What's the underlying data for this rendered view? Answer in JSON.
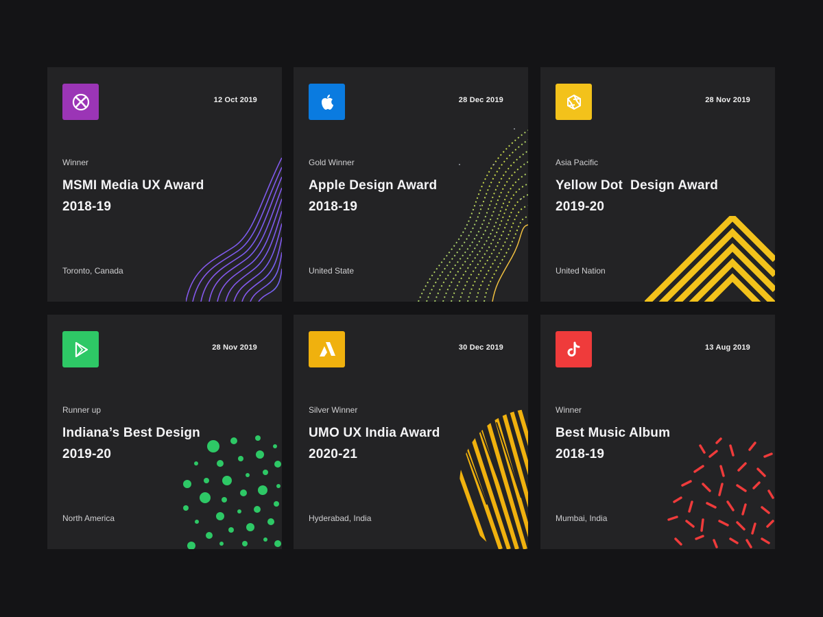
{
  "cards": [
    {
      "date": "12 Oct 2019",
      "label": "Winner",
      "title_line1": "MSMI Media UX Award",
      "title_line2": "2018-19",
      "location": "Toronto, Canada",
      "icon": "xbox-icon",
      "color": "#9b35b6"
    },
    {
      "date": "28 Dec 2019",
      "label": "Gold Winner",
      "title_line1": "Apple Design Award",
      "title_line2": "2018-19",
      "location": "United State",
      "icon": "apple-icon",
      "color": "#0a7be0"
    },
    {
      "date": "28 Nov 2019",
      "label": "Asia Pacific",
      "title_line1": "Yellow Dot  Design Award",
      "title_line2": "2019-20",
      "location": "United Nation",
      "icon": "aperture-icon",
      "color": "#f3c21b"
    },
    {
      "date": "28 Nov 2019",
      "label": "Runner up",
      "title_line1": "Indiana’s Best Design",
      "title_line2": "2019-20",
      "location": "North America",
      "icon": "play-icon",
      "color": "#2ec866"
    },
    {
      "date": "30 Dec 2019",
      "label": "Silver Winner",
      "title_line1": "UMO UX India Award",
      "title_line2": "2020-21",
      "location": "Hyderabad, India",
      "icon": "adsense-icon",
      "color": "#f0b10e"
    },
    {
      "date": "13 Aug 2019",
      "label": "Winner",
      "title_line1": "Best Music Album",
      "title_line2": "2018-19",
      "location": "Mumbai, India",
      "icon": "tiktok-icon",
      "color": "#ef3b3b"
    }
  ]
}
